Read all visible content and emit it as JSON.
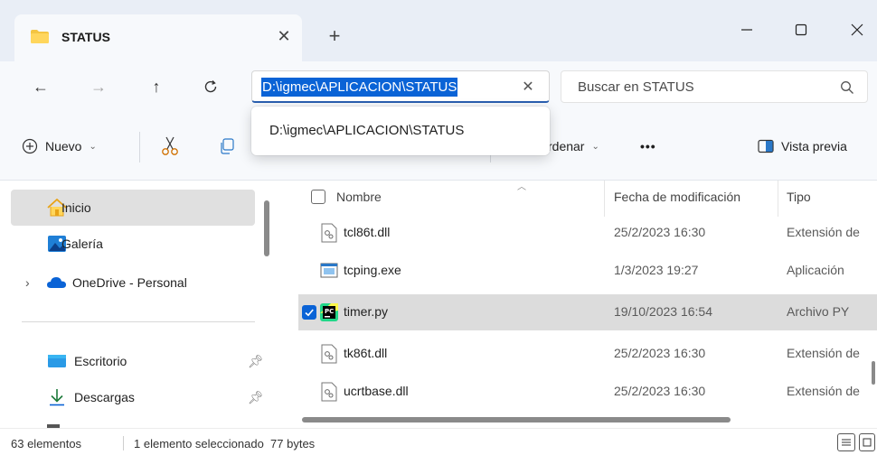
{
  "tab": {
    "title": "STATUS"
  },
  "address": {
    "value": "D:\\igmec\\APLICACION\\STATUS",
    "suggestion": "D:\\igmec\\APLICACION\\STATUS"
  },
  "search": {
    "placeholder": "Buscar en STATUS"
  },
  "toolbar": {
    "new_label": "Nuevo",
    "sort_label": "rdenar",
    "more_label": "•••",
    "preview_label": "Vista previa"
  },
  "sidebar": {
    "items": [
      {
        "label": "Inicio",
        "icon": "home-icon"
      },
      {
        "label": "Galería",
        "icon": "gallery-icon"
      },
      {
        "label": "OneDrive - Personal",
        "icon": "cloud-icon"
      },
      {
        "label": "Escritorio",
        "icon": "desktop-icon"
      },
      {
        "label": "Descargas",
        "icon": "download-icon"
      }
    ]
  },
  "filelist": {
    "columns": [
      "Nombre",
      "Fecha de modificación",
      "Tipo"
    ],
    "rows": [
      {
        "name": "tcl86t.dll",
        "date": "25/2/2023 16:30",
        "type": "Extensión de",
        "icon": "dll-icon"
      },
      {
        "name": "tcping.exe",
        "date": "1/3/2023 19:27",
        "type": "Aplicación",
        "icon": "exe-icon"
      },
      {
        "name": "timer.py",
        "date": "19/10/2023 16:54",
        "type": "Archivo PY",
        "icon": "pycharm-icon",
        "selected": true
      },
      {
        "name": "tk86t.dll",
        "date": "25/2/2023 16:30",
        "type": "Extensión de",
        "icon": "dll-icon"
      },
      {
        "name": "ucrtbase.dll",
        "date": "25/2/2023 16:30",
        "type": "Extensión de",
        "icon": "dll-icon"
      }
    ]
  },
  "status": {
    "count": "63 elementos",
    "selection": "1 elemento seleccionado  77 bytes"
  },
  "colors": {
    "accent": "#0a63d6",
    "folder": "#f4c542",
    "chrome": "#e9eef6"
  }
}
